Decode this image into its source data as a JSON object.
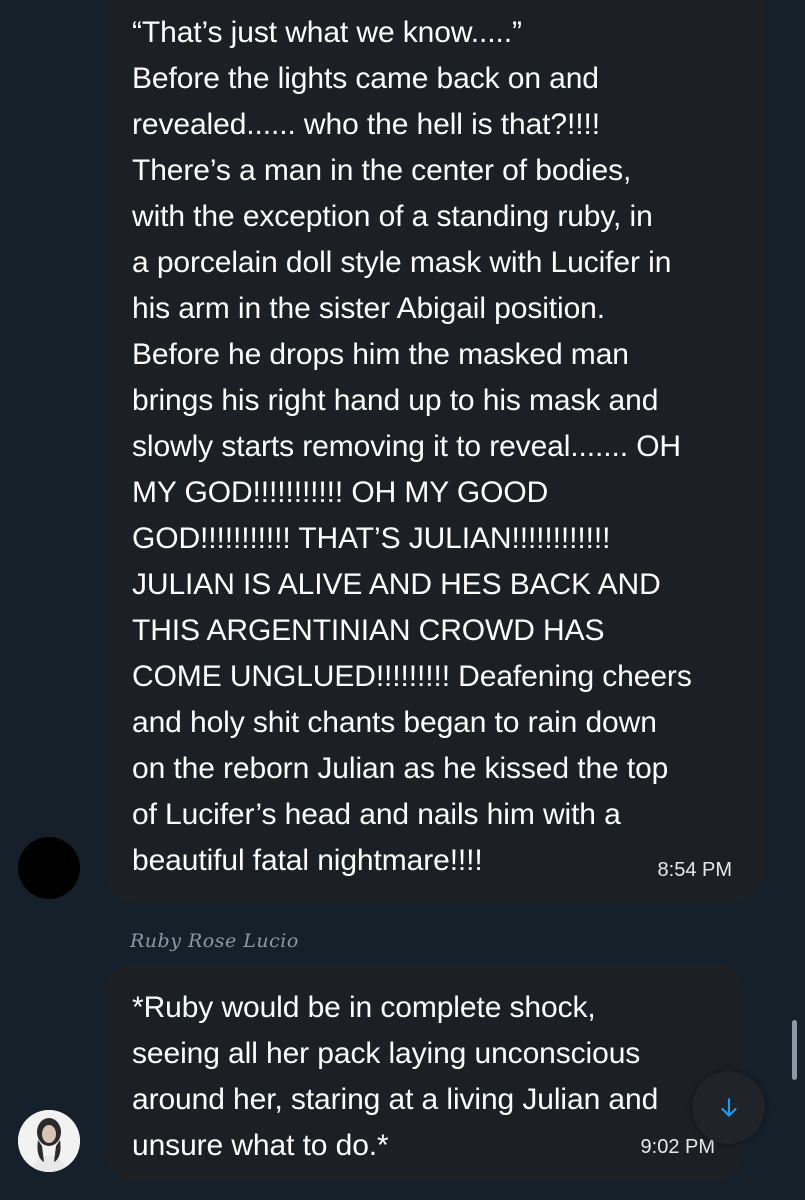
{
  "messages": [
    {
      "text": "“That’s just what we know.....”\nBefore the lights came back on and\nrevealed...... who the hell is that?!!!!\nThere’s a man in the center of bodies,\nwith the exception of a standing ruby, in\na porcelain doll style mask with Lucifer in\nhis arm in the sister Abigail position.\nBefore he drops him the masked man\nbrings his right hand up to his mask and\nslowly starts removing it to reveal....... OH\nMY GOD!!!!!!!!!!! OH MY GOOD\nGOD!!!!!!!!!!! THAT’S JULIAN!!!!!!!!!!!!\nJULIAN IS ALIVE AND HES BACK AND\nTHIS ARGENTINIAN CROWD HAS\nCOME UNGLUED!!!!!!!!! Deafening cheers\nand holy shit chants began to rain down\non the reborn Julian as he kissed the top\nof Lucifer’s head and nails him with a\nbeautiful fatal nightmare!!!!",
      "time": "8:54 PM"
    },
    {
      "sender": "Ruby Rose Lucio",
      "text": "*Ruby would be in complete shock,\nseeing all her pack laying unconscious\naround her, staring at a living Julian and\nunsure what to do.*",
      "time": "9:02 PM"
    }
  ],
  "icons": {
    "scroll_down": "arrow-down-icon"
  },
  "colors": {
    "background": "#15202b",
    "bubble": "#1c1f23",
    "text": "#ffffff",
    "accent": "#1d9bf0"
  }
}
